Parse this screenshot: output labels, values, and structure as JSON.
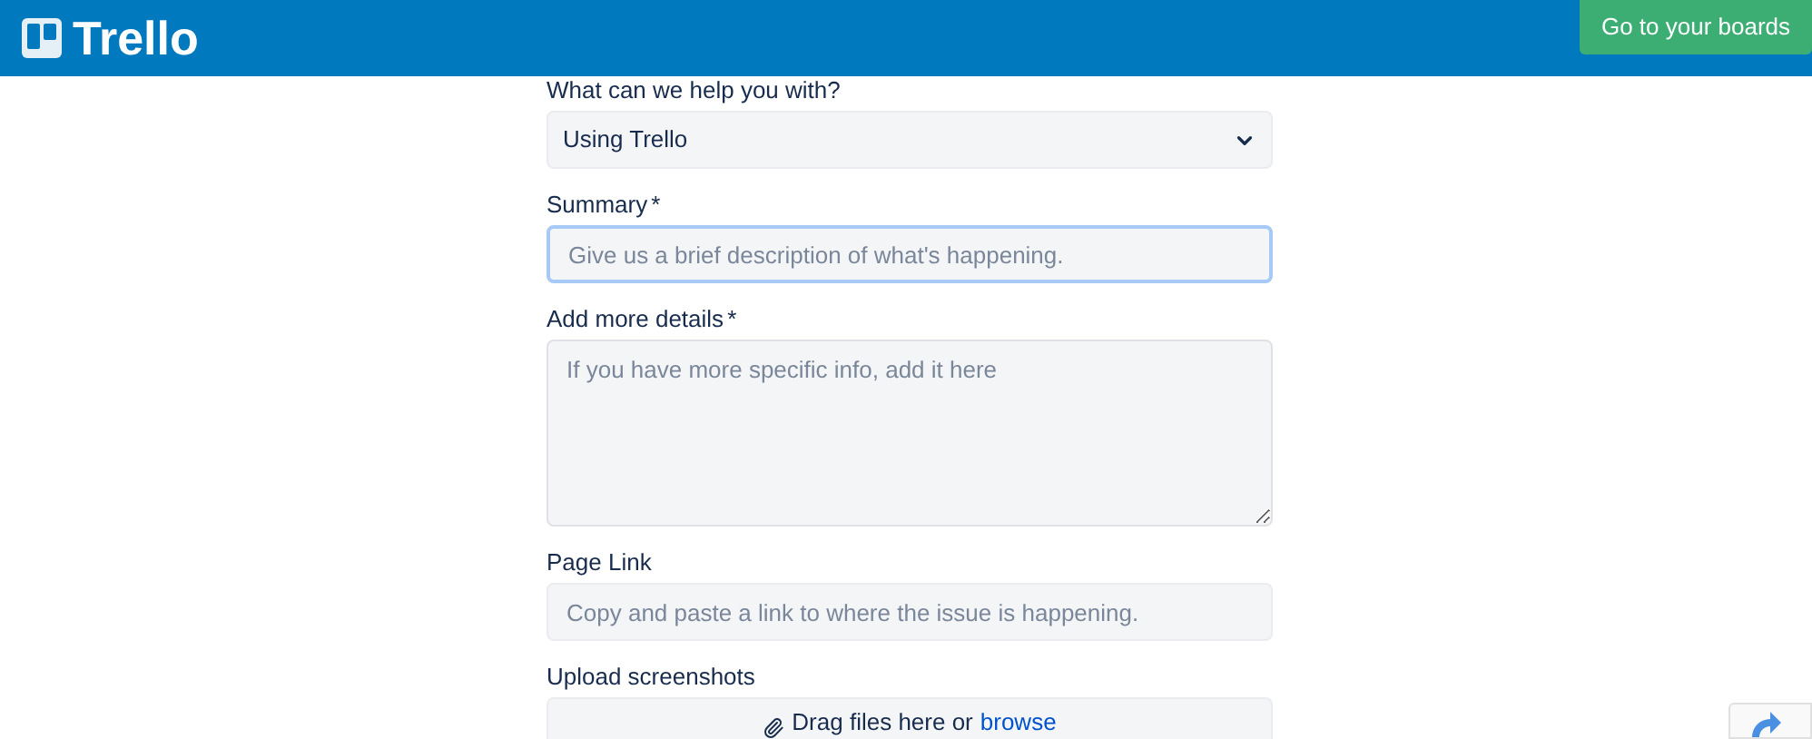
{
  "header": {
    "logo_text": "Trello",
    "button": "Go to your boards"
  },
  "form": {
    "fields": [
      {
        "kind": "select",
        "label": "What can we help you with?",
        "value": "Using Trello"
      },
      {
        "kind": "input",
        "label": "Summary",
        "required_mark": "*",
        "placeholder": "Give us a brief description of what's happening.",
        "focused": true
      },
      {
        "kind": "textarea",
        "label": "Add more details",
        "required_mark": "*",
        "placeholder": "If you have more specific info, add it here",
        "focused": false
      },
      {
        "kind": "input",
        "label": "Page Link",
        "placeholder": "Copy and paste a link to where the issue is happening.",
        "focused": false
      },
      {
        "kind": "upload",
        "label": "Upload screenshots",
        "text": "Drag files here or",
        "link": "browse"
      }
    ]
  }
}
